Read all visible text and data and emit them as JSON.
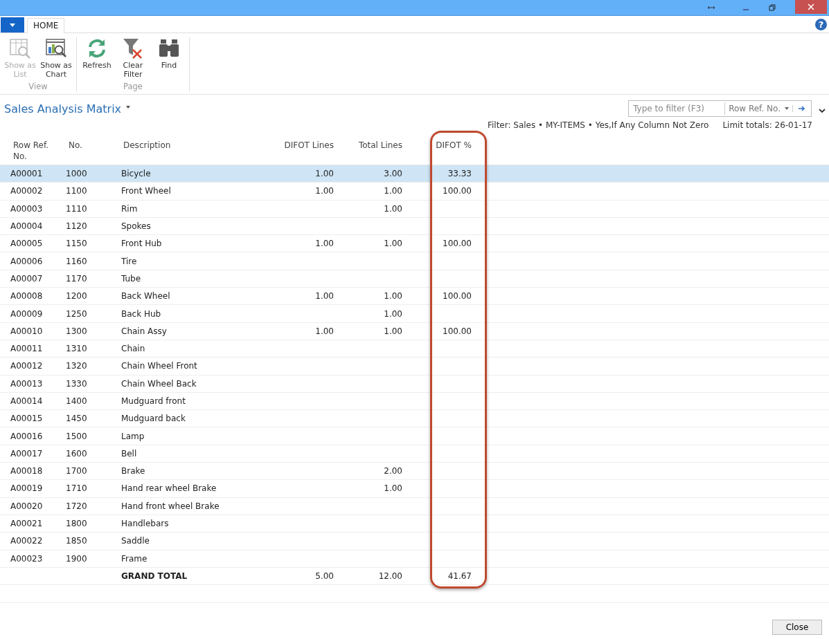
{
  "help": "?",
  "tabs": [
    {
      "label": "HOME",
      "selected": true
    }
  ],
  "ribbon_groups": [
    {
      "label": "View",
      "buttons": [
        {
          "kind": "list",
          "label": "Show as List",
          "disabled": true
        },
        {
          "kind": "chart",
          "label": "Show as Chart",
          "disabled": false
        }
      ]
    },
    {
      "label": "Page",
      "buttons": [
        {
          "kind": "refresh",
          "label": "Refresh",
          "disabled": false
        },
        {
          "kind": "clear-filter",
          "label": "Clear Filter",
          "disabled": false
        },
        {
          "kind": "find",
          "label": "Find",
          "disabled": false
        }
      ]
    }
  ],
  "page_title": "Sales Analysis Matrix",
  "search": {
    "placeholder": "Type to filter (F3)",
    "field": "Row Ref. No."
  },
  "filter_text": "Filter: Sales • MY-ITEMS • Yes,If Any Column Not Zero",
  "limit_text": "Limit totals: 26-01-17",
  "table": {
    "columns": [
      "Row Ref. No.",
      "No.",
      "Description",
      "DIFOT Lines",
      "Total Lines",
      "DIFOT %"
    ],
    "rows": [
      {
        "kind": "item",
        "selected": true,
        "cells": [
          "A00001",
          "1000",
          "Bicycle",
          "1.00",
          "3.00",
          "33.33"
        ]
      },
      {
        "kind": "item",
        "selected": false,
        "cells": [
          "A00002",
          "1100",
          "Front Wheel",
          "1.00",
          "1.00",
          "100.00"
        ]
      },
      {
        "kind": "item",
        "selected": false,
        "cells": [
          "A00003",
          "1110",
          "Rim",
          "",
          "1.00",
          ""
        ]
      },
      {
        "kind": "item",
        "selected": false,
        "cells": [
          "A00004",
          "1120",
          "Spokes",
          "",
          "",
          ""
        ]
      },
      {
        "kind": "item",
        "selected": false,
        "cells": [
          "A00005",
          "1150",
          "Front Hub",
          "1.00",
          "1.00",
          "100.00"
        ]
      },
      {
        "kind": "item",
        "selected": false,
        "cells": [
          "A00006",
          "1160",
          "Tire",
          "",
          "",
          ""
        ]
      },
      {
        "kind": "item",
        "selected": false,
        "cells": [
          "A00007",
          "1170",
          "Tube",
          "",
          "",
          ""
        ]
      },
      {
        "kind": "item",
        "selected": false,
        "cells": [
          "A00008",
          "1200",
          "Back Wheel",
          "1.00",
          "1.00",
          "100.00"
        ]
      },
      {
        "kind": "item",
        "selected": false,
        "cells": [
          "A00009",
          "1250",
          "Back Hub",
          "",
          "1.00",
          ""
        ]
      },
      {
        "kind": "item",
        "selected": false,
        "cells": [
          "A00010",
          "1300",
          "Chain Assy",
          "1.00",
          "1.00",
          "100.00"
        ]
      },
      {
        "kind": "item",
        "selected": false,
        "cells": [
          "A00011",
          "1310",
          "Chain",
          "",
          "",
          ""
        ]
      },
      {
        "kind": "item",
        "selected": false,
        "cells": [
          "A00012",
          "1320",
          "Chain Wheel Front",
          "",
          "",
          ""
        ]
      },
      {
        "kind": "item",
        "selected": false,
        "cells": [
          "A00013",
          "1330",
          "Chain Wheel Back",
          "",
          "",
          ""
        ]
      },
      {
        "kind": "item",
        "selected": false,
        "cells": [
          "A00014",
          "1400",
          "Mudguard front",
          "",
          "",
          ""
        ]
      },
      {
        "kind": "item",
        "selected": false,
        "cells": [
          "A00015",
          "1450",
          "Mudguard back",
          "",
          "",
          ""
        ]
      },
      {
        "kind": "item",
        "selected": false,
        "cells": [
          "A00016",
          "1500",
          "Lamp",
          "",
          "",
          ""
        ]
      },
      {
        "kind": "item",
        "selected": false,
        "cells": [
          "A00017",
          "1600",
          "Bell",
          "",
          "",
          ""
        ]
      },
      {
        "kind": "item",
        "selected": false,
        "cells": [
          "A00018",
          "1700",
          "Brake",
          "",
          "2.00",
          ""
        ]
      },
      {
        "kind": "item",
        "selected": false,
        "cells": [
          "A00019",
          "1710",
          "Hand rear wheel Brake",
          "",
          "1.00",
          ""
        ]
      },
      {
        "kind": "item",
        "selected": false,
        "cells": [
          "A00020",
          "1720",
          "Hand front wheel Brake",
          "",
          "",
          ""
        ]
      },
      {
        "kind": "item",
        "selected": false,
        "cells": [
          "A00021",
          "1800",
          "Handlebars",
          "",
          "",
          ""
        ]
      },
      {
        "kind": "item",
        "selected": false,
        "cells": [
          "A00022",
          "1850",
          "Saddle",
          "",
          "",
          ""
        ]
      },
      {
        "kind": "item",
        "selected": false,
        "cells": [
          "A00023",
          "1900",
          "Frame",
          "",
          "",
          ""
        ]
      },
      {
        "kind": "total",
        "selected": false,
        "cells": [
          "",
          "",
          "GRAND TOTAL",
          "5.00",
          "12.00",
          "41.67"
        ]
      }
    ]
  },
  "close_button": "Close"
}
